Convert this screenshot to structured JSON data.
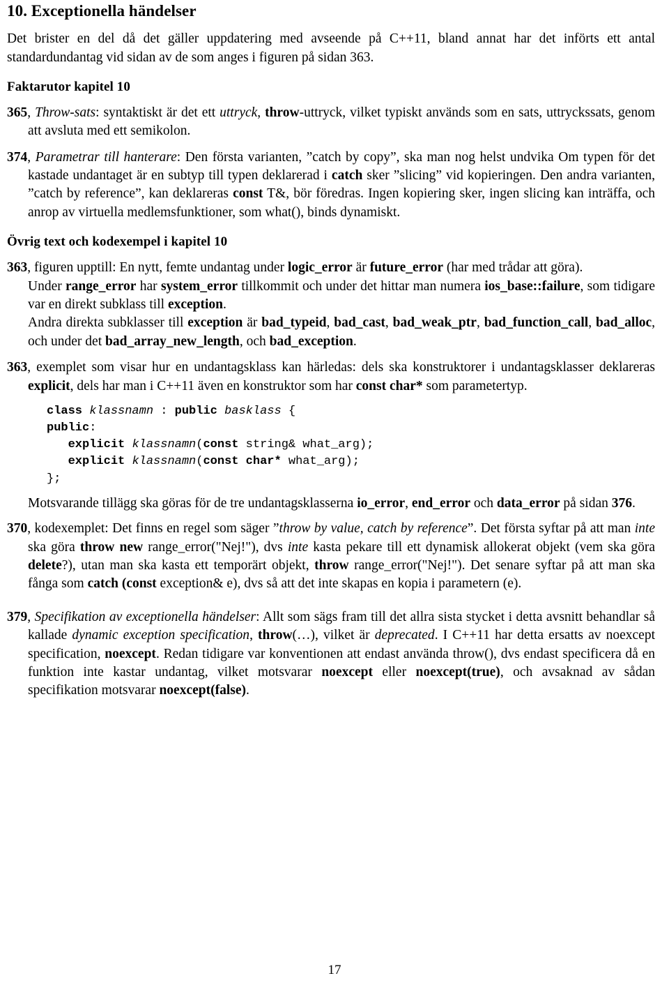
{
  "document": {
    "page_number": "17",
    "language": "sv"
  },
  "section": {
    "heading": "10. Exceptionella händelser",
    "intro_line1": "Det brister en del då det gäller uppdatering med avseende på C++11, bland annat har det införts ett antal",
    "intro_line2": "standardundantag vid sidan av de som anges i figuren på sidan 363."
  },
  "subheading_faktarutor": "Faktarutor kapitel 10",
  "entries_faktarutor": [
    {
      "page": "365",
      "title": "Throw-sats",
      "text_a": ": syntaktiskt är det ett ",
      "em_1": "uttryck",
      "text_b": ", ",
      "bold_1": "throw",
      "text_c": "-uttryck, vilket typiskt används som en sats, uttryckssats, genom att avsluta med ett semikolon."
    },
    {
      "page": "374",
      "title": "Parametrar till hanterare",
      "text_a": ": Den första varianten, ”catch by copy”, ska man nog helst undvika Om typen för det kastade undantaget är en subtyp till typen deklarerad i ",
      "bold_1": "catch",
      "text_b": " sker ”slicing” vid kopieringen. Den andra varianten, ”catch by reference”, kan deklareras ",
      "bold_2": "const",
      "text_c": " T&, bör föredras. Ingen kopiering sker, ingen slicing kan inträffa, och anrop av virtuella medlemsfunktioner, som what(), binds dynamiskt."
    }
  ],
  "subheading_ovrig": "Övrig text och kodexempel i kapitel 10",
  "entry_363_figure": {
    "page": "363",
    "line1_a": ", figuren upptill: En nytt, femte undantag under ",
    "line1_bold_1": "logic_error",
    "line1_b": " är ",
    "line1_bold_2": "future_error",
    "line1_c": " (har med trådar att göra).",
    "line2_a": "Under ",
    "line2_bold_1": "range_error",
    "line2_b": " har ",
    "line2_bold_2": "system_error",
    "line2_c": " tillkommit och under det hittar man numera ",
    "line2_bold_3": "ios_base::failure",
    "line2_d": ", som tidigare var en direkt subklass till ",
    "line2_bold_4": "exception",
    "line2_e": ".",
    "line3_a": "Andra direkta subklasser till ",
    "line3_bold_1": "exception",
    "line3_b": " är ",
    "line3_bold_2": "bad_typeid",
    "line3_c": ", ",
    "line3_bold_3": "bad_cast",
    "line3_d": ", ",
    "line3_bold_4": "bad_weak_ptr",
    "line3_e": ", ",
    "line3_bold_5": "bad_function_call",
    "line3_f": ", ",
    "line3_bold_6": "bad_alloc",
    "line3_g": ", och under det ",
    "line3_bold_7": "bad_array_new_length",
    "line3_h": ", och ",
    "line3_bold_8": "bad_exception",
    "line3_i": "."
  },
  "entry_363_example": {
    "page": "363",
    "text_a": ", exemplet som visar hur en undantagsklass kan härledas: dels ska konstruktorer i undantagsklasser deklareras ",
    "bold_1": "explicit",
    "text_b": ", dels har man i C++11 även en konstruktor som har ",
    "bold_2": "const char*",
    "text_c": " som parametertyp."
  },
  "code_example": {
    "lines": [
      [
        {
          "t": "class ",
          "s": "kw"
        },
        {
          "t": "klassnamn",
          "s": "ph"
        },
        {
          "t": " : ",
          "s": "pl"
        },
        {
          "t": "public ",
          "s": "kw"
        },
        {
          "t": "basklass",
          "s": "ph"
        },
        {
          "t": " {",
          "s": "pl"
        }
      ],
      [
        {
          "t": "public",
          "s": "kw"
        },
        {
          "t": ":",
          "s": "pl"
        }
      ],
      [
        {
          "t": "   ",
          "s": "pl"
        },
        {
          "t": "explicit ",
          "s": "kw"
        },
        {
          "t": "klassnamn",
          "s": "ph"
        },
        {
          "t": "(",
          "s": "pl"
        },
        {
          "t": "const",
          "s": "kw"
        },
        {
          "t": " string& what_arg);",
          "s": "pl"
        }
      ],
      [
        {
          "t": "   ",
          "s": "pl"
        },
        {
          "t": "explicit ",
          "s": "kw"
        },
        {
          "t": "klassnamn",
          "s": "ph"
        },
        {
          "t": "(",
          "s": "pl"
        },
        {
          "t": "const char*",
          "s": "kw"
        },
        {
          "t": " what_arg);",
          "s": "pl"
        }
      ],
      [
        {
          "t": "};",
          "s": "pl"
        }
      ]
    ]
  },
  "paragraph_motsvarande": {
    "text_a": "Motsvarande tillägg ska göras för de tre undantagsklasserna ",
    "bold_1": "io_error",
    "text_b": ", ",
    "bold_2": "end_error",
    "text_c": " och ",
    "bold_3": "data_error",
    "text_d": " på sidan ",
    "bold_4": "376",
    "text_e": "."
  },
  "entry_370": {
    "page": "370",
    "text_a": ", kodexemplet: Det finns en regel som säger ”",
    "em_1": "throw by value, catch by reference",
    "text_b": "”. Det första syftar på att man ",
    "em_2": "inte",
    "text_c": " ska göra ",
    "bold_1": "throw new",
    "text_d": " range_error(\"Nej!\"), dvs ",
    "em_3": "inte",
    "text_e": " kasta pekare till ett dynamisk allokerat objekt (vem ska göra ",
    "bold_2": "delete",
    "text_f": "?), utan man ska kasta ett temporärt objekt, ",
    "bold_3": "throw",
    "text_g": " range_error(\"Nej!\"). Det senare syftar på att man ska fånga som ",
    "bold_4": "catch (const",
    "text_h": " exception& e), dvs så att det inte skapas en kopia i parametern (e)."
  },
  "entry_379": {
    "page": "379",
    "title": "Specifikation av exceptionella händelser",
    "text_a": ": Allt som sägs fram till det allra sista stycket i detta avsnitt behandlar så kallade ",
    "em_1": "dynamic exception specification",
    "text_b": ", ",
    "bold_1": "throw",
    "text_c": "(…), vilket är ",
    "em_2": "deprecated",
    "text_d": ". I C++11 har detta ersatts av noexcept specification, ",
    "bold_2": "noexcept",
    "text_e": ". Redan tidigare var konventionen att endast använda throw(), dvs endast specificera då en funktion inte kastar undantag, vilket motsvarar ",
    "bold_3": "noexcept",
    "text_f": " eller ",
    "bold_4": "noexcept(true)",
    "text_g": ", och avsaknad av sådan specifikation motsvarar ",
    "bold_5": "noexcept(false)",
    "text_h": "."
  }
}
